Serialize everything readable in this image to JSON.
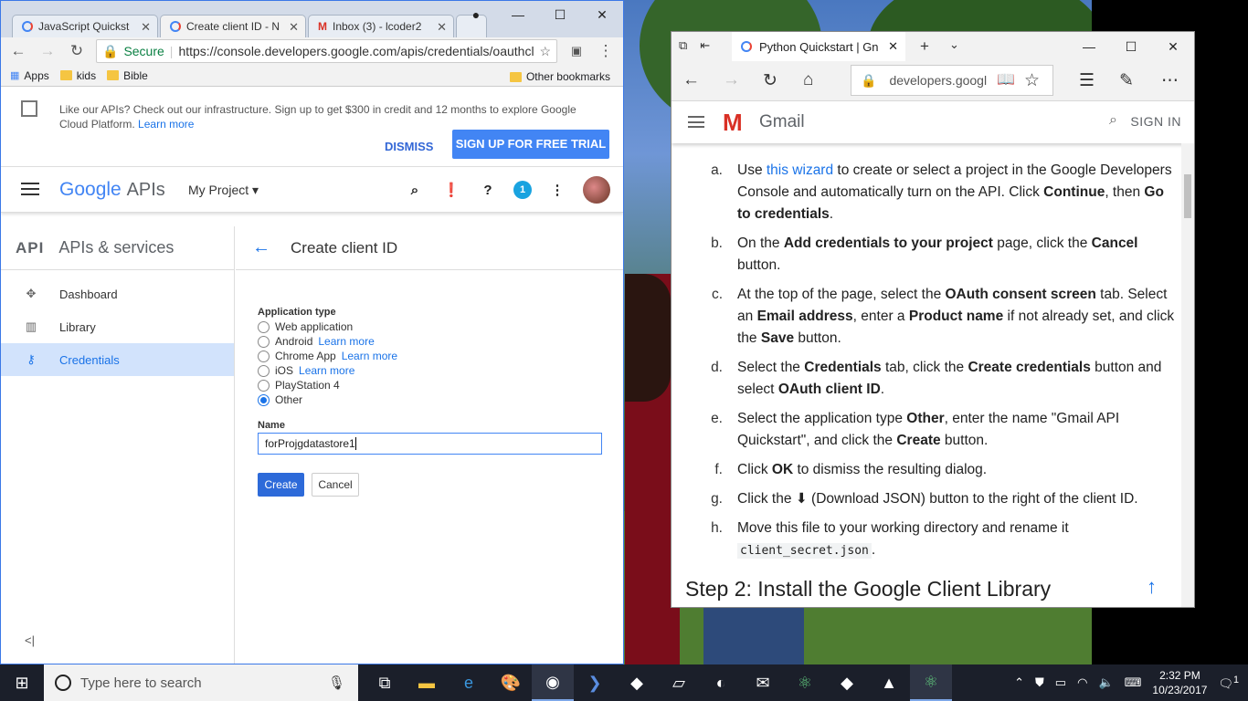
{
  "chrome": {
    "tabs": [
      {
        "label": "JavaScript Quickst",
        "icon": "google-g-icon"
      },
      {
        "label": "Create client ID - N",
        "icon": "google-g-icon"
      },
      {
        "label": "Inbox (3) - lcoder2",
        "icon": "gmail-icon"
      }
    ],
    "address": {
      "secure": "Secure",
      "url": "https://console.developers.google.com/apis/credentials/oauthcl..."
    },
    "bookmarks": [
      "Apps",
      "kids",
      "Bible"
    ],
    "other_bookmarks": "Other bookmarks",
    "promo": {
      "text": "Like our APIs? Check out our infrastructure. Sign up to get $300 in credit and 12 months to explore Google Cloud Platform.",
      "link": "Learn more",
      "dismiss": "DISMISS",
      "trial": "SIGN UP FOR FREE TRIAL"
    },
    "appbar": {
      "logo_google": "Google",
      "logo_apis": "APIs",
      "project": "My Project",
      "notif_count": "1"
    },
    "sidebar": {
      "title": "APIs & services",
      "api_badge": "API",
      "items": [
        {
          "label": "Dashboard"
        },
        {
          "label": "Library"
        },
        {
          "label": "Credentials"
        }
      ]
    },
    "main": {
      "title": "Create client ID",
      "app_type_label": "Application type",
      "options": [
        {
          "label": "Web application",
          "link": ""
        },
        {
          "label": "Android",
          "link": "Learn more"
        },
        {
          "label": "Chrome App",
          "link": "Learn more"
        },
        {
          "label": "iOS",
          "link": "Learn more"
        },
        {
          "label": "PlayStation 4",
          "link": ""
        },
        {
          "label": "Other",
          "link": ""
        }
      ],
      "selected": "Other",
      "name_label": "Name",
      "name_value": "forProjgdatastore1",
      "create": "Create",
      "cancel": "Cancel"
    }
  },
  "edge": {
    "tab_title": "Python Quickstart  |  Gn",
    "address": "developers.googl",
    "app_name": "Gmail",
    "sign_in": "SIGN IN",
    "steps": [
      {
        "k": "a.",
        "parts": [
          "Use ",
          "this wizard",
          " to create or select a project in the Google Developers Console and automatically turn on the API. Click ",
          "Continue",
          ", then ",
          "Go to credentials",
          "."
        ]
      },
      {
        "k": "b.",
        "parts": [
          "On the ",
          "Add credentials to your project",
          " page, click the ",
          "Cancel",
          " button."
        ]
      },
      {
        "k": "c.",
        "parts": [
          "At the top of the page, select the ",
          "OAuth consent screen",
          " tab. Select an ",
          "Email address",
          ", enter a ",
          "Product name",
          " if not already set, and click the ",
          "Save",
          " button."
        ]
      },
      {
        "k": "d.",
        "parts": [
          "Select the ",
          "Credentials",
          " tab, click the ",
          "Create credentials",
          " button and select ",
          "OAuth client ID",
          "."
        ]
      },
      {
        "k": "e.",
        "parts": [
          "Select the application type ",
          "Other",
          ", enter the name \"Gmail API Quickstart\", and click the ",
          "Create",
          " button."
        ]
      },
      {
        "k": "f.",
        "parts": [
          "Click ",
          "OK",
          " to dismiss the resulting dialog."
        ]
      },
      {
        "k": "g.",
        "parts": [
          "Click the ",
          "⬇",
          " (Download JSON) button to the right of the client ID."
        ]
      },
      {
        "k": "h.",
        "parts": [
          "Move this file to your working directory and rename it ",
          "client_secret.json",
          "."
        ]
      }
    ],
    "step2": "Step 2: Install the Google Client Library"
  },
  "taskbar": {
    "search_placeholder": "Type here to search",
    "time": "2:32 PM",
    "date": "10/23/2017",
    "notifications": "1"
  }
}
